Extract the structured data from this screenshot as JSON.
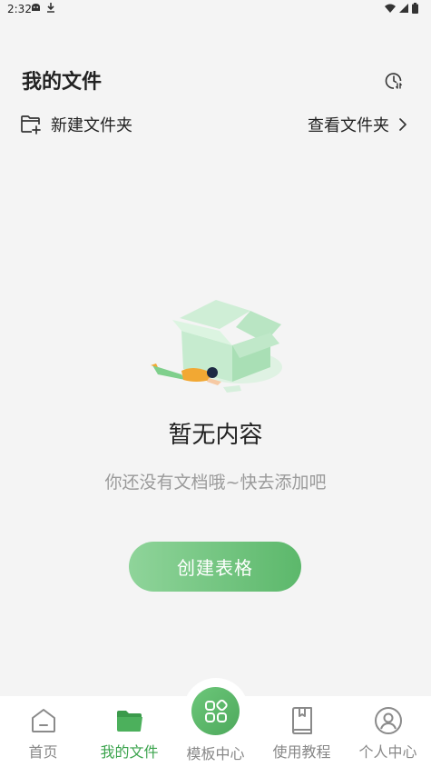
{
  "status_bar": {
    "time": "2:32"
  },
  "header": {
    "title": "我的文件"
  },
  "toolbar": {
    "new_folder_label": "新建文件夹",
    "view_folder_label": "查看文件夹"
  },
  "empty_state": {
    "title": "暂无内容",
    "subtitle": "你还没有文档哦~快去添加吧",
    "create_button_label": "创建表格"
  },
  "bottom_nav": {
    "items": [
      {
        "label": "首页",
        "icon": "home-icon"
      },
      {
        "label": "我的文件",
        "icon": "folder-icon",
        "active": true
      },
      {
        "label": "模板中心",
        "icon": "grid-icon"
      },
      {
        "label": "使用教程",
        "icon": "book-icon"
      },
      {
        "label": "个人中心",
        "icon": "user-icon"
      }
    ]
  },
  "colors": {
    "accent": "#4ea95c",
    "background": "#f4f4f4"
  }
}
